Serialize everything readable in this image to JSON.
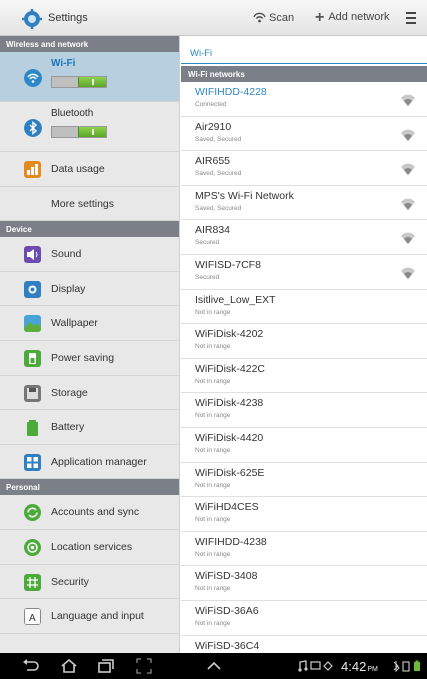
{
  "action_bar": {
    "title": "Settings",
    "app_icon": "settings-gear-icon",
    "scan_label": "Scan",
    "scan_icon": "scan-wifi-icon",
    "add_network_label": "Add network",
    "add_icon": "plus-icon",
    "overflow_icon": "overflow-menu-icon"
  },
  "left_pane": {
    "sections": [
      {
        "header": "Wireless and network"
      },
      {
        "header": "Device"
      },
      {
        "header": "Personal"
      }
    ],
    "wifi": {
      "label": "Wi-Fi",
      "icon": "wifi-icon",
      "toggle_on": true
    },
    "bluetooth": {
      "label": "Bluetooth",
      "icon": "bluetooth-icon",
      "toggle_on": true
    },
    "data_usage": {
      "label": "Data usage",
      "icon": "data-usage-icon"
    },
    "more_settings": {
      "label": "More settings"
    },
    "device_items": [
      {
        "label": "Sound",
        "icon": "sound-icon"
      },
      {
        "label": "Display",
        "icon": "display-icon"
      },
      {
        "label": "Wallpaper",
        "icon": "wallpaper-icon"
      },
      {
        "label": "Power saving",
        "icon": "power-saving-icon"
      },
      {
        "label": "Storage",
        "icon": "storage-icon"
      },
      {
        "label": "Battery",
        "icon": "battery-icon"
      },
      {
        "label": "Application manager",
        "icon": "application-manager-icon"
      }
    ],
    "personal_items": [
      {
        "label": "Accounts and sync",
        "icon": "accounts-sync-icon"
      },
      {
        "label": "Location services",
        "icon": "location-icon"
      },
      {
        "label": "Security",
        "icon": "security-icon"
      },
      {
        "label": "Language and input",
        "icon": "language-icon"
      }
    ]
  },
  "right_pane": {
    "title": "Wi-Fi",
    "section_header": "Wi-Fi networks",
    "networks": [
      {
        "ssid": "WIFIHDD-4228",
        "status": "Connected",
        "signal": "wifi-signal-icon"
      },
      {
        "ssid": "Air2910",
        "status": "Saved, Secured",
        "signal": "wifi-signal-icon"
      },
      {
        "ssid": "AIR655",
        "status": "Saved, Secured",
        "signal": "wifi-signal-icon"
      },
      {
        "ssid": "MPS's Wi-Fi Network",
        "status": "Saved, Secured",
        "signal": "wifi-signal-icon"
      },
      {
        "ssid": "AIR834",
        "status": "Secured",
        "signal": "wifi-signal-icon"
      },
      {
        "ssid": "WIFISD-7CF8",
        "status": "Secured",
        "signal": "wifi-signal-icon"
      },
      {
        "ssid": "Isitlive_Low_EXT",
        "status": "Not in range"
      },
      {
        "ssid": "WiFiDisk-4202",
        "status": "Not in range"
      },
      {
        "ssid": "WiFiDisk-422C",
        "status": "Not in range"
      },
      {
        "ssid": "WiFiDisk-4238",
        "status": "Not in range"
      },
      {
        "ssid": "WiFiDisk-4420",
        "status": "Not in range"
      },
      {
        "ssid": "WiFiDisk-625E",
        "status": "Not in range"
      },
      {
        "ssid": "WiFiHD4CES",
        "status": "Not in range"
      },
      {
        "ssid": "WIFIHDD-4238",
        "status": "Not in range"
      },
      {
        "ssid": "WiFiSD-3408",
        "status": "Not in range"
      },
      {
        "ssid": "WiFiSD-36A6",
        "status": "Not in range"
      },
      {
        "ssid": "WiFiSD-36C4",
        "status": ""
      }
    ]
  },
  "nav_bar": {
    "buttons": [
      "back-icon",
      "home-icon",
      "recent-apps-icon",
      "screenshot-icon",
      "up-arrow-icon"
    ],
    "time": "4:42",
    "ampm": "PM",
    "status_icons": [
      "music-icon",
      "screen-mirror-icon",
      "wifi-status-icon",
      "bluetooth-status-icon",
      "signal-icon",
      "battery-status-icon"
    ]
  },
  "colors": {
    "accent": "#2d88c8",
    "section_header": "#7b8088",
    "selected_row": "#b8cfe0",
    "toggle_on": "#6cba34"
  }
}
